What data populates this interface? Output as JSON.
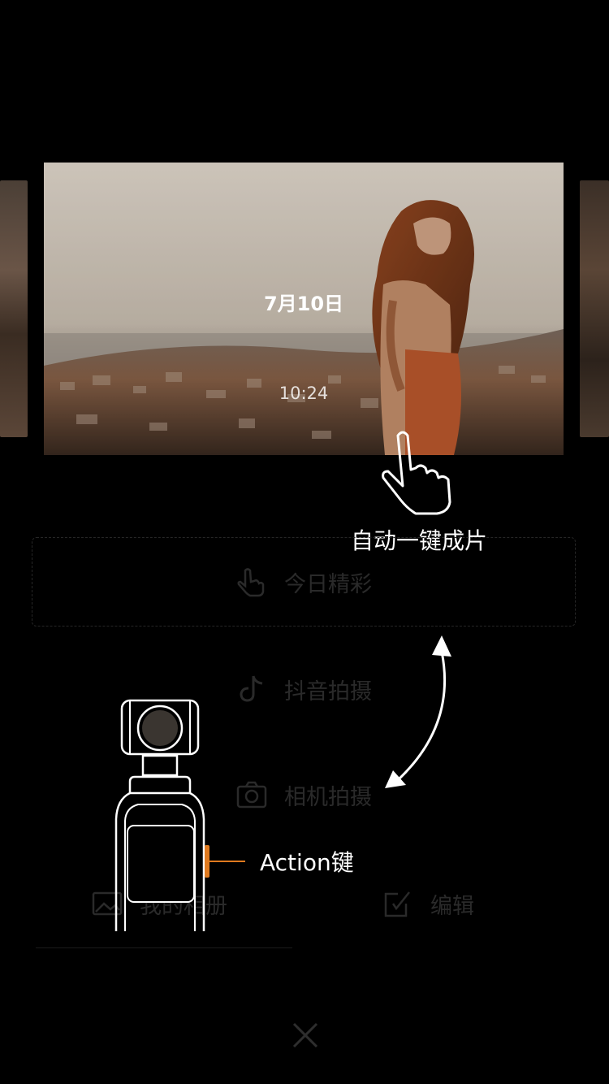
{
  "card": {
    "date": "7月10日",
    "time": "10:24"
  },
  "menu": {
    "today_label": "今日精彩",
    "douyin_label": "抖音拍摄",
    "camera_label": "相机拍摄",
    "album_label": "我的相册",
    "edit_label": "编辑"
  },
  "overlay": {
    "auto_tip": "自动一键成片",
    "action_label": "Action键"
  },
  "icons": {
    "tap": "hand-tap-icon",
    "douyin": "douyin-icon",
    "camera": "camera-icon",
    "album": "album-icon",
    "edit": "edit-icon",
    "close": "close-icon"
  },
  "colors": {
    "action_button": "#e07a1f",
    "background": "#000000"
  }
}
